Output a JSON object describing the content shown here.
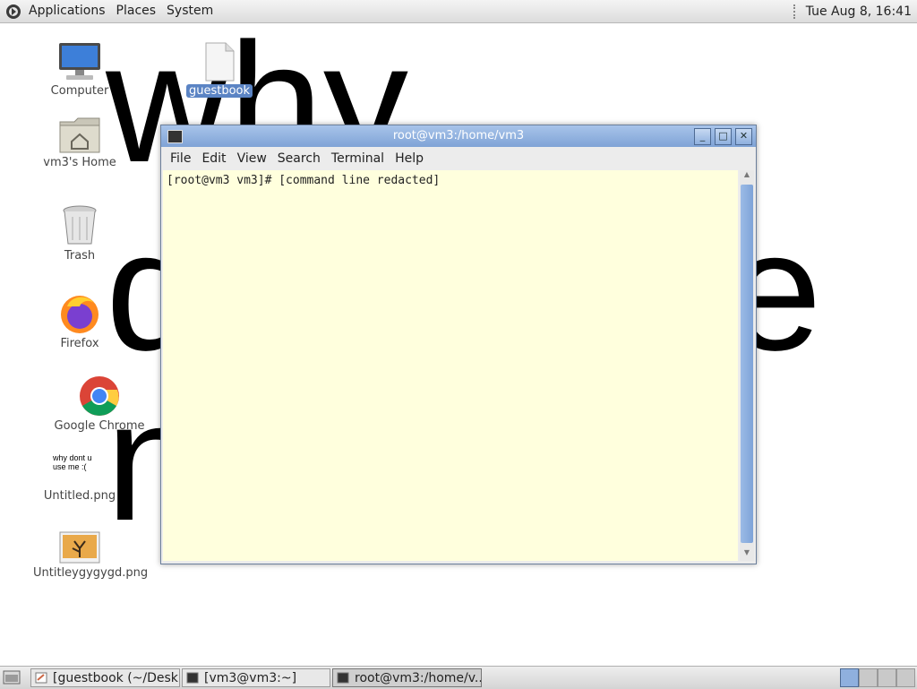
{
  "top_panel": {
    "menus": [
      "Applications",
      "Places",
      "System"
    ],
    "clock": "Tue Aug  8, 16:41"
  },
  "wallpaper_text": [
    "why",
    "d",
    "e",
    "n"
  ],
  "desktop_icons": [
    {
      "label": "Computer"
    },
    {
      "label": "guestbook",
      "selected": true
    },
    {
      "label": "vm3's Home"
    },
    {
      "label": "Trash"
    },
    {
      "label": "Firefox"
    },
    {
      "label": "Google Chrome"
    },
    {
      "label": "Untitled.png",
      "thumb_text": "why dont u use me :("
    },
    {
      "label": "Untitleygygygd.png"
    }
  ],
  "terminal": {
    "title": "root@vm3:/home/vm3",
    "menu": [
      "File",
      "Edit",
      "View",
      "Search",
      "Terminal",
      "Help"
    ],
    "prompt_line": "[root@vm3 vm3]# [command line redacted]"
  },
  "taskbar": {
    "tasks": [
      {
        "label": "[guestbook (~/Desk..."
      },
      {
        "label": "[vm3@vm3:~]"
      },
      {
        "label": "root@vm3:/home/v...",
        "active": true
      }
    ],
    "workspaces": 4,
    "current_workspace": 1
  },
  "colors": {
    "titlebar": "#7fa3d6",
    "terminal_bg": "#ffffdd",
    "selection": "#5b84c4"
  }
}
